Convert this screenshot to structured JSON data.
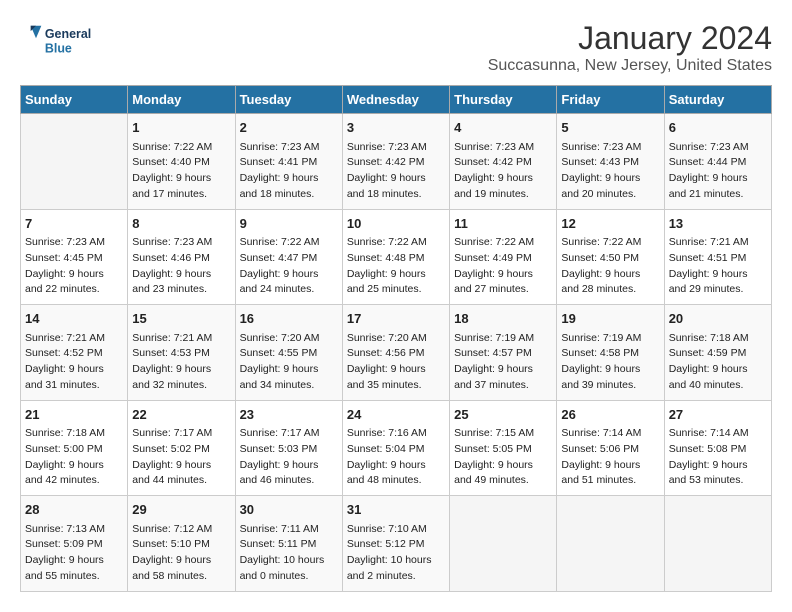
{
  "header": {
    "logo_line1": "General",
    "logo_line2": "Blue",
    "title": "January 2024",
    "subtitle": "Succasunna, New Jersey, United States"
  },
  "days_of_week": [
    "Sunday",
    "Monday",
    "Tuesday",
    "Wednesday",
    "Thursday",
    "Friday",
    "Saturday"
  ],
  "weeks": [
    [
      {
        "date": "",
        "content": ""
      },
      {
        "date": "1",
        "content": "Sunrise: 7:22 AM\nSunset: 4:40 PM\nDaylight: 9 hours\nand 17 minutes."
      },
      {
        "date": "2",
        "content": "Sunrise: 7:23 AM\nSunset: 4:41 PM\nDaylight: 9 hours\nand 18 minutes."
      },
      {
        "date": "3",
        "content": "Sunrise: 7:23 AM\nSunset: 4:42 PM\nDaylight: 9 hours\nand 18 minutes."
      },
      {
        "date": "4",
        "content": "Sunrise: 7:23 AM\nSunset: 4:42 PM\nDaylight: 9 hours\nand 19 minutes."
      },
      {
        "date": "5",
        "content": "Sunrise: 7:23 AM\nSunset: 4:43 PM\nDaylight: 9 hours\nand 20 minutes."
      },
      {
        "date": "6",
        "content": "Sunrise: 7:23 AM\nSunset: 4:44 PM\nDaylight: 9 hours\nand 21 minutes."
      }
    ],
    [
      {
        "date": "7",
        "content": "Sunrise: 7:23 AM\nSunset: 4:45 PM\nDaylight: 9 hours\nand 22 minutes."
      },
      {
        "date": "8",
        "content": "Sunrise: 7:23 AM\nSunset: 4:46 PM\nDaylight: 9 hours\nand 23 minutes."
      },
      {
        "date": "9",
        "content": "Sunrise: 7:22 AM\nSunset: 4:47 PM\nDaylight: 9 hours\nand 24 minutes."
      },
      {
        "date": "10",
        "content": "Sunrise: 7:22 AM\nSunset: 4:48 PM\nDaylight: 9 hours\nand 25 minutes."
      },
      {
        "date": "11",
        "content": "Sunrise: 7:22 AM\nSunset: 4:49 PM\nDaylight: 9 hours\nand 27 minutes."
      },
      {
        "date": "12",
        "content": "Sunrise: 7:22 AM\nSunset: 4:50 PM\nDaylight: 9 hours\nand 28 minutes."
      },
      {
        "date": "13",
        "content": "Sunrise: 7:21 AM\nSunset: 4:51 PM\nDaylight: 9 hours\nand 29 minutes."
      }
    ],
    [
      {
        "date": "14",
        "content": "Sunrise: 7:21 AM\nSunset: 4:52 PM\nDaylight: 9 hours\nand 31 minutes."
      },
      {
        "date": "15",
        "content": "Sunrise: 7:21 AM\nSunset: 4:53 PM\nDaylight: 9 hours\nand 32 minutes."
      },
      {
        "date": "16",
        "content": "Sunrise: 7:20 AM\nSunset: 4:55 PM\nDaylight: 9 hours\nand 34 minutes."
      },
      {
        "date": "17",
        "content": "Sunrise: 7:20 AM\nSunset: 4:56 PM\nDaylight: 9 hours\nand 35 minutes."
      },
      {
        "date": "18",
        "content": "Sunrise: 7:19 AM\nSunset: 4:57 PM\nDaylight: 9 hours\nand 37 minutes."
      },
      {
        "date": "19",
        "content": "Sunrise: 7:19 AM\nSunset: 4:58 PM\nDaylight: 9 hours\nand 39 minutes."
      },
      {
        "date": "20",
        "content": "Sunrise: 7:18 AM\nSunset: 4:59 PM\nDaylight: 9 hours\nand 40 minutes."
      }
    ],
    [
      {
        "date": "21",
        "content": "Sunrise: 7:18 AM\nSunset: 5:00 PM\nDaylight: 9 hours\nand 42 minutes."
      },
      {
        "date": "22",
        "content": "Sunrise: 7:17 AM\nSunset: 5:02 PM\nDaylight: 9 hours\nand 44 minutes."
      },
      {
        "date": "23",
        "content": "Sunrise: 7:17 AM\nSunset: 5:03 PM\nDaylight: 9 hours\nand 46 minutes."
      },
      {
        "date": "24",
        "content": "Sunrise: 7:16 AM\nSunset: 5:04 PM\nDaylight: 9 hours\nand 48 minutes."
      },
      {
        "date": "25",
        "content": "Sunrise: 7:15 AM\nSunset: 5:05 PM\nDaylight: 9 hours\nand 49 minutes."
      },
      {
        "date": "26",
        "content": "Sunrise: 7:14 AM\nSunset: 5:06 PM\nDaylight: 9 hours\nand 51 minutes."
      },
      {
        "date": "27",
        "content": "Sunrise: 7:14 AM\nSunset: 5:08 PM\nDaylight: 9 hours\nand 53 minutes."
      }
    ],
    [
      {
        "date": "28",
        "content": "Sunrise: 7:13 AM\nSunset: 5:09 PM\nDaylight: 9 hours\nand 55 minutes."
      },
      {
        "date": "29",
        "content": "Sunrise: 7:12 AM\nSunset: 5:10 PM\nDaylight: 9 hours\nand 58 minutes."
      },
      {
        "date": "30",
        "content": "Sunrise: 7:11 AM\nSunset: 5:11 PM\nDaylight: 10 hours\nand 0 minutes."
      },
      {
        "date": "31",
        "content": "Sunrise: 7:10 AM\nSunset: 5:12 PM\nDaylight: 10 hours\nand 2 minutes."
      },
      {
        "date": "",
        "content": ""
      },
      {
        "date": "",
        "content": ""
      },
      {
        "date": "",
        "content": ""
      }
    ]
  ]
}
